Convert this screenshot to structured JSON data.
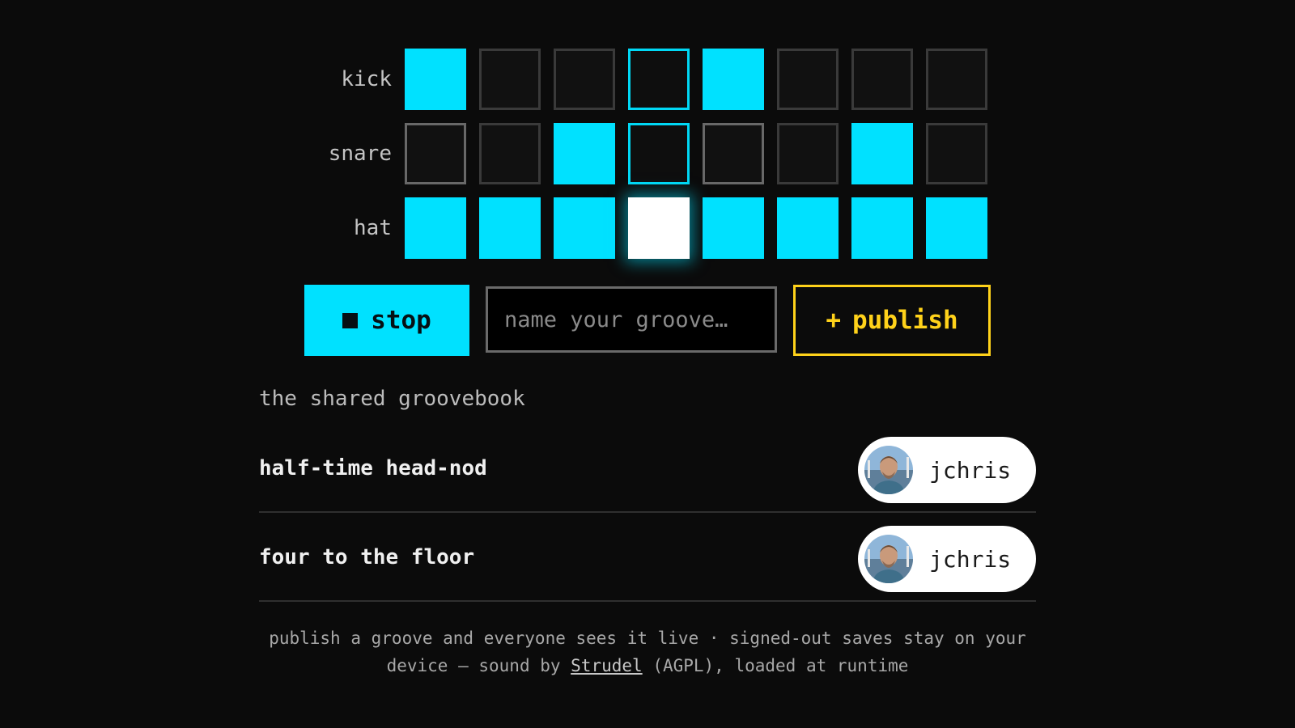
{
  "sequencer": {
    "tracks": [
      {
        "label": "kick",
        "steps": [
          1,
          0,
          0,
          0,
          1,
          0,
          0,
          0
        ]
      },
      {
        "label": "snare",
        "steps": [
          0,
          0,
          1,
          0,
          0,
          0,
          1,
          0
        ]
      },
      {
        "label": "hat",
        "steps": [
          1,
          1,
          1,
          1,
          1,
          1,
          1,
          1
        ]
      }
    ],
    "playhead_step": 4,
    "colors": {
      "active": "#00e1ff",
      "playhead_hit": "#ffffff",
      "inactive_border": "#3a3a3a"
    }
  },
  "controls": {
    "stop_label": "stop",
    "stop_icon": "stop-square-icon",
    "name_placeholder": "name your groove…",
    "name_value": "",
    "publish_icon": "+",
    "publish_label": "publish",
    "accent_color": "#00e1ff",
    "publish_color": "#ffd21a"
  },
  "groovebook": {
    "heading": "the shared groovebook",
    "grooves": [
      {
        "name": "half-time head-nod",
        "author": "jchris",
        "avatar": "user-avatar"
      },
      {
        "name": "four to the floor",
        "author": "jchris",
        "avatar": "user-avatar"
      }
    ]
  },
  "footer": {
    "text_before_link": "publish a groove and everyone sees it live · signed-out saves stay on your device — sound by ",
    "link_text": "Strudel",
    "text_after_link": " (AGPL), loaded at runtime"
  }
}
